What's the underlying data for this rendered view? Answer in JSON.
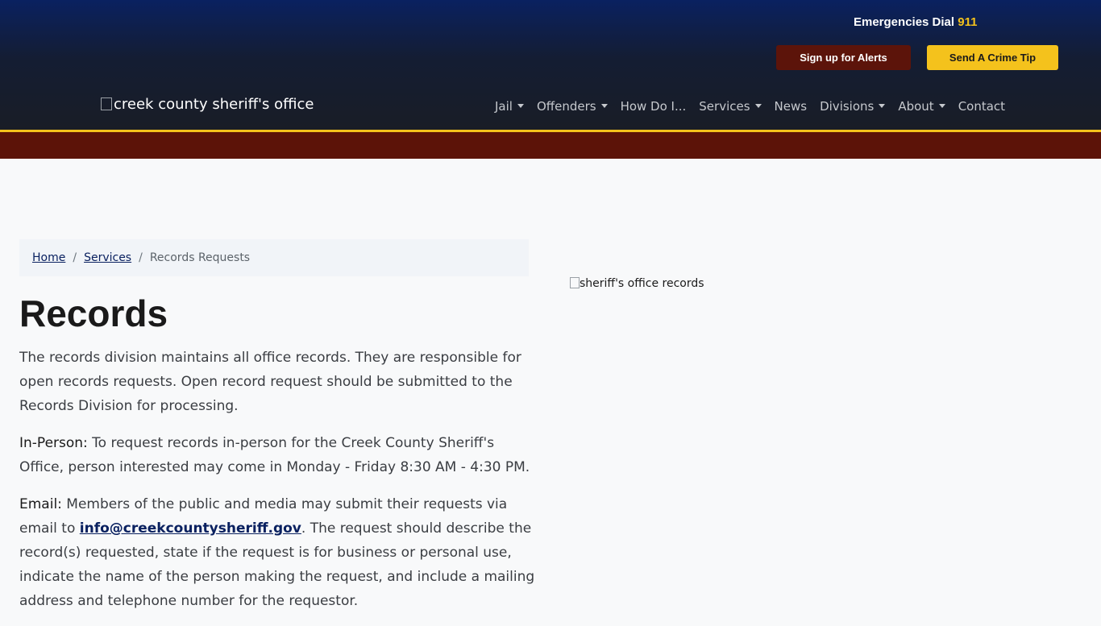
{
  "header": {
    "emergency_prefix": "Emergencies Dial",
    "emergency_number": "911",
    "alerts_button": "Sign up for Alerts",
    "tip_button": "Send A Crime Tip",
    "logo_alt": "creek county sheriff's office",
    "nav": [
      {
        "label": "Jail",
        "dropdown": true
      },
      {
        "label": "Offenders",
        "dropdown": true
      },
      {
        "label": "How Do I...",
        "dropdown": false
      },
      {
        "label": "Services",
        "dropdown": true
      },
      {
        "label": "News",
        "dropdown": false
      },
      {
        "label": "Divisions",
        "dropdown": true
      },
      {
        "label": "About",
        "dropdown": true
      },
      {
        "label": "Contact",
        "dropdown": false
      }
    ]
  },
  "breadcrumb": {
    "home": "Home",
    "separator": "/",
    "services": "Services",
    "current": "Records Requests"
  },
  "main": {
    "title": "Records",
    "intro": "The records division maintains all office records. They are responsible for open records requests. Open record request should be submitted to the Records Division for processing.",
    "in_person_label": "In-Person:",
    "in_person_text": " To request records in-person for the Creek County Sheriff's Office, person interested may come in Monday - Friday 8:30 AM - 4:30 PM.",
    "email_label": "Email:",
    "email_text_before": " Members of the public and media may submit their requests via email to ",
    "email_link": "info@creekcountysheriff.gov",
    "email_text_after": ". The request should describe the record(s) requested, state if the request is for business or personal use, indicate the name of the person making the request, and include a mailing address and telephone number for the requestor.",
    "side_image_alt": "sheriff's office records"
  },
  "colors": {
    "header_top": "#0a2160",
    "header_bottom": "#191d26",
    "accent_gold": "#f4c21c",
    "maroon": "#5c1308",
    "link": "#0a2160"
  }
}
